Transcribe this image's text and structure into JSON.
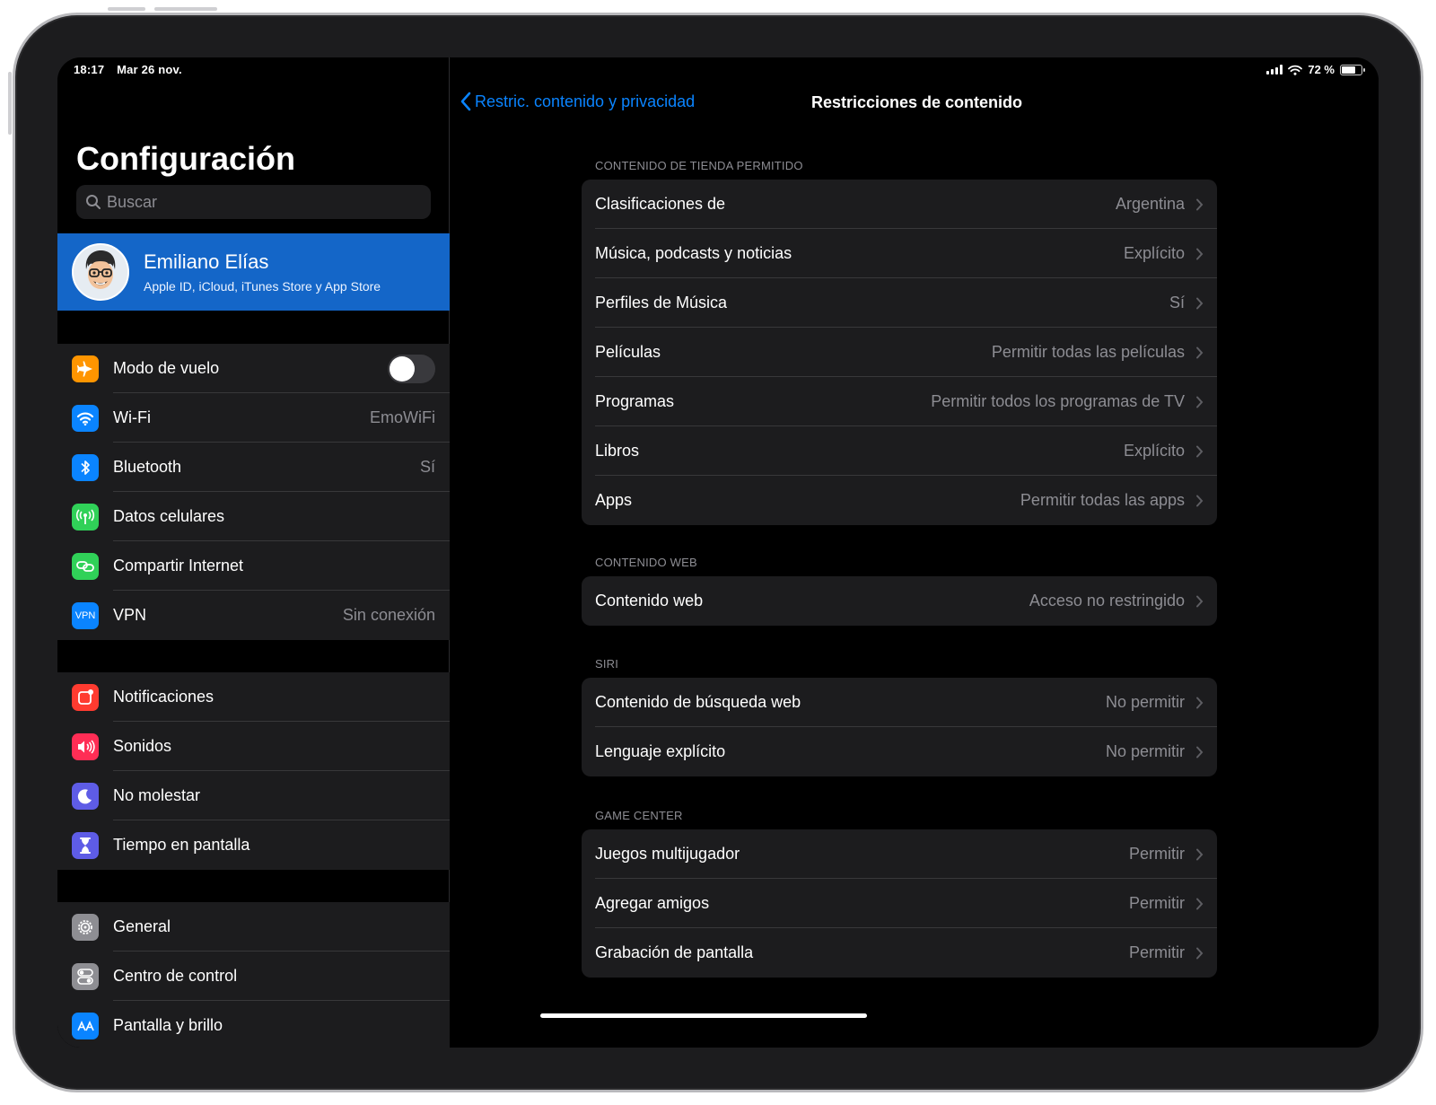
{
  "status_bar": {
    "time": "18:17",
    "date": "Mar 26 nov.",
    "battery_text": "72 %",
    "battery_level": 0.72,
    "icons": [
      "cellular-signal-icon",
      "wifi-icon",
      "battery-icon"
    ]
  },
  "sidebar": {
    "title": "Configuración",
    "search_placeholder": "Buscar",
    "profile": {
      "name": "Emiliano Elías",
      "subtitle": "Apple ID, iCloud, iTunes Store y App Store"
    },
    "group1": [
      {
        "label": "Modo de vuelo",
        "value": "",
        "icon": "airplane-icon",
        "color": "#ff9500",
        "toggle": false
      },
      {
        "label": "Wi-Fi",
        "value": "EmoWiFi",
        "icon": "wifi-icon",
        "color": "#0a84ff"
      },
      {
        "label": "Bluetooth",
        "value": "Sí",
        "icon": "bluetooth-icon",
        "color": "#0a84ff"
      },
      {
        "label": "Datos celulares",
        "value": "",
        "icon": "antenna-icon",
        "color": "#30d158"
      },
      {
        "label": "Compartir Internet",
        "value": "",
        "icon": "hotspot-icon",
        "color": "#30d158"
      },
      {
        "label": "VPN",
        "value": "Sin conexión",
        "icon": "vpn-icon",
        "icon_text": "VPN",
        "color": "#0a84ff"
      }
    ],
    "group2": [
      {
        "label": "Notificaciones",
        "icon": "notifications-icon",
        "color": "#ff3b30"
      },
      {
        "label": "Sonidos",
        "icon": "sound-icon",
        "color": "#ff2d55"
      },
      {
        "label": "No molestar",
        "icon": "moon-icon",
        "color": "#5e5ce6"
      },
      {
        "label": "Tiempo en pantalla",
        "icon": "hourglass-icon",
        "color": "#5e5ce6"
      }
    ],
    "group3": [
      {
        "label": "General",
        "icon": "gear-icon",
        "color": "#8e8e93"
      },
      {
        "label": "Centro de control",
        "icon": "toggles-icon",
        "color": "#8e8e93"
      },
      {
        "label": "Pantalla y brillo",
        "icon": "display-icon",
        "color": "#0a84ff"
      }
    ]
  },
  "detail": {
    "back_label": "Restric. contenido y privacidad",
    "title": "Restricciones de contenido",
    "sections": [
      {
        "header": "CONTENIDO DE TIENDA PERMITIDO",
        "rows": [
          {
            "label": "Clasificaciones de",
            "value": "Argentina"
          },
          {
            "label": "Música, podcasts y noticias",
            "value": "Explícito"
          },
          {
            "label": "Perfiles de Música",
            "value": "Sí"
          },
          {
            "label": "Películas",
            "value": "Permitir todas las películas"
          },
          {
            "label": "Programas",
            "value": "Permitir todos los programas de TV"
          },
          {
            "label": "Libros",
            "value": "Explícito"
          },
          {
            "label": "Apps",
            "value": "Permitir todas las apps"
          }
        ]
      },
      {
        "header": "CONTENIDO WEB",
        "rows": [
          {
            "label": "Contenido web",
            "value": "Acceso no restringido"
          }
        ]
      },
      {
        "header": "SIRI",
        "rows": [
          {
            "label": "Contenido de búsqueda web",
            "value": "No permitir"
          },
          {
            "label": "Lenguaje explícito",
            "value": "No permitir"
          }
        ]
      },
      {
        "header": "GAME CENTER",
        "rows": [
          {
            "label": "Juegos multijugador",
            "value": "Permitir"
          },
          {
            "label": "Agregar amigos",
            "value": "Permitir"
          },
          {
            "label": "Grabación de pantalla",
            "value": "Permitir"
          }
        ]
      }
    ]
  }
}
